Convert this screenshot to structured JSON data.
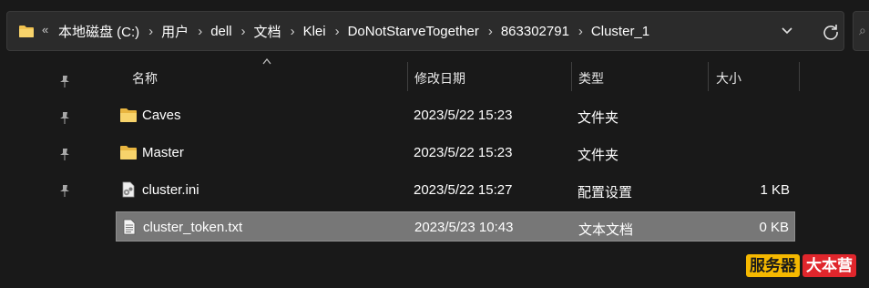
{
  "address_bar": {
    "overflow_glyph": "«",
    "separator": "›",
    "breadcrumbs": [
      "本地磁盘 (C:)",
      "用户",
      "dell",
      "文档",
      "Klei",
      "DoNotStarveTogether",
      "863302791",
      "Cluster_1"
    ],
    "dropdown_icon": "chevron-down-icon",
    "refresh_icon": "refresh-icon"
  },
  "quick_access": {
    "pins": [
      "pin-icon",
      "pin-icon",
      "pin-icon",
      "pin-icon"
    ]
  },
  "file_list": {
    "sort_column": "名称",
    "columns": {
      "name": "名称",
      "date": "修改日期",
      "type": "类型",
      "size": "大小"
    },
    "rows": [
      {
        "name": "Caves",
        "date": "2023/5/22 15:23",
        "type": "文件夹",
        "size": "",
        "icon": "folder-icon",
        "selected": false
      },
      {
        "name": "Master",
        "date": "2023/5/22 15:23",
        "type": "文件夹",
        "size": "",
        "icon": "folder-icon",
        "selected": false
      },
      {
        "name": "cluster.ini",
        "date": "2023/5/22 15:27",
        "type": "配置设置",
        "size": "1 KB",
        "icon": "config-file-icon",
        "selected": false
      },
      {
        "name": "cluster_token.txt",
        "date": "2023/5/23 10:43",
        "type": "文本文档",
        "size": "0 KB",
        "icon": "text-file-icon",
        "selected": true
      }
    ]
  },
  "watermark": {
    "left": "服务器",
    "right": "大本营"
  },
  "colors": {
    "background": "#191919",
    "address_bar": "#2b2b2b",
    "selection": "#777777",
    "folder": "#f0c250",
    "watermark_yellow": "#f5b800",
    "watermark_red": "#e0262c"
  }
}
